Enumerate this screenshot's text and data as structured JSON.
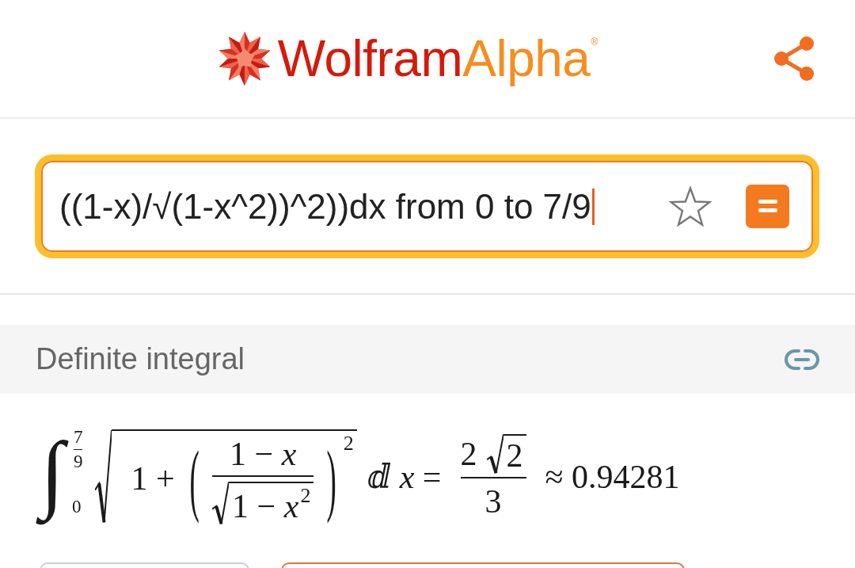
{
  "header": {
    "logo": {
      "parts": [
        {
          "text": "Wolfram",
          "color": "#d41a0c"
        },
        {
          "text": "Alpha",
          "color": "#f58e1f"
        }
      ],
      "registered_mark": "®"
    }
  },
  "search": {
    "value": "((1-x)/√(1-x^2))^2))dx from 0 to 7/9",
    "focused": true
  },
  "pod": {
    "title": "Definite integral",
    "formula": [
      {
        "kind": "integral",
        "sign": "∫",
        "upper": {
          "kind": "frac",
          "num": "7",
          "den": "9"
        },
        "lower": "0"
      },
      {
        "kind": "sqrt",
        "body": [
          "1 +",
          {
            "kind": "sup",
            "base": {
              "kind": "fence",
              "open": "(",
              "close": ")",
              "body": {
                "kind": "frac",
                "num": "1 − *x*",
                "den": {
                  "kind": "sqrt",
                  "body": {
                    "kind": "sup",
                    "base": "1 − *x*",
                    "sup": "2"
                  }
                }
              }
            },
            "sup": "2"
          }
        ]
      },
      "ⅆ *x* =",
      {
        "kind": "frac",
        "num": [
          "2",
          {
            "kind": "sqrt",
            "body": "2"
          }
        ],
        "den": "3"
      },
      "≈ 0.94281"
    ]
  },
  "bottom_buttons": [
    {
      "color": "#b9d5dd"
    },
    {
      "color": "#e0733f"
    }
  ]
}
